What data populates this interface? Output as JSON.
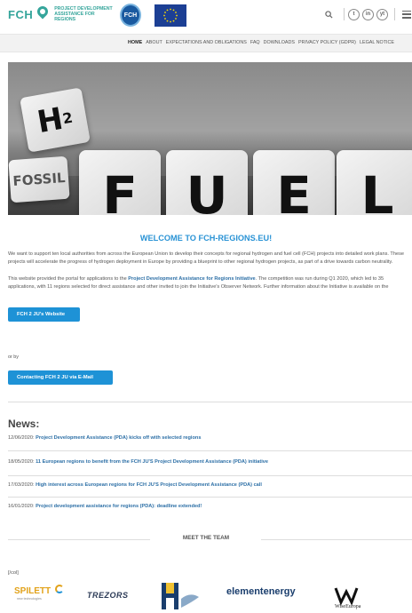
{
  "header": {
    "brand": "FCH",
    "brand_sub": "PROJECT DEVELOPMENT ASSISTANCE FOR REGIONS",
    "fch_logo_text": "FCH",
    "social": [
      "t",
      "in",
      "yt"
    ]
  },
  "nav": {
    "items": [
      "HOME",
      "ABOUT",
      "EXPECTATIONS AND OBLIGATIONS",
      "FAQ",
      "DOWNLOADS",
      "PRIVACY POLICY (GDPR)",
      "LEGAL NOTICE"
    ]
  },
  "hero": {
    "h2_die": "H",
    "h2_sub": "2",
    "fossil_die": "FOSSIL",
    "letters": [
      "F",
      "U",
      "E",
      "L"
    ]
  },
  "main": {
    "title": "WELCOME TO FCH-REGIONS.EU!",
    "para1": "We want to support ten local authorities from across the European Union to develop their concepts for regional hydrogen and fuel cell (FCH) projects into detailed work plans. These projects will accelerate the progress of hydrogen deployment in Europe by providing a blueprint to other regional hydrogen projects, as part of a drive towards carbon neutrality.",
    "para2_a": "This website provided the portal for applications to the ",
    "para2_link": "Project Development Assistance for Regions Initiative",
    "para2_b": ". The competition was run during Q1 2020, which led to 35 applications, with 11 regions selected for direct assistance and other invited to join the Initiative's Observer Network. Further information about the Initiative is available on the",
    "btn_website": "FCH 2 JU's Website",
    "or_by": "or by",
    "btn_email": "Contacting FCH 2 JU via E-Mail"
  },
  "news": {
    "title": "News:",
    "items": [
      {
        "date": "12/06/2020:",
        "title": "Project Development Assistance (PDA) kicks off with selected regions"
      },
      {
        "date": "18/05/2020:",
        "title": "11 European regions to benefit from the FCH JU'S Project Development Assistance (PDA) initiative"
      },
      {
        "date": "17/03/2020:",
        "title": "High interest across European regions for FCH JU'S Project Development Assistance (PDA) call"
      },
      {
        "date": "16/01/2020:",
        "title": "Project development assistance for regions (PDA): deadline extended!"
      }
    ]
  },
  "team": {
    "label": "MEET THE TEAM",
    "col_tag": "[/col]",
    "logos": {
      "spilett": "SPILETT",
      "spilett_sub": "new technologies",
      "trezors": "TREZORS",
      "element": "elementenergy",
      "wise": "WiseEuropa"
    }
  }
}
